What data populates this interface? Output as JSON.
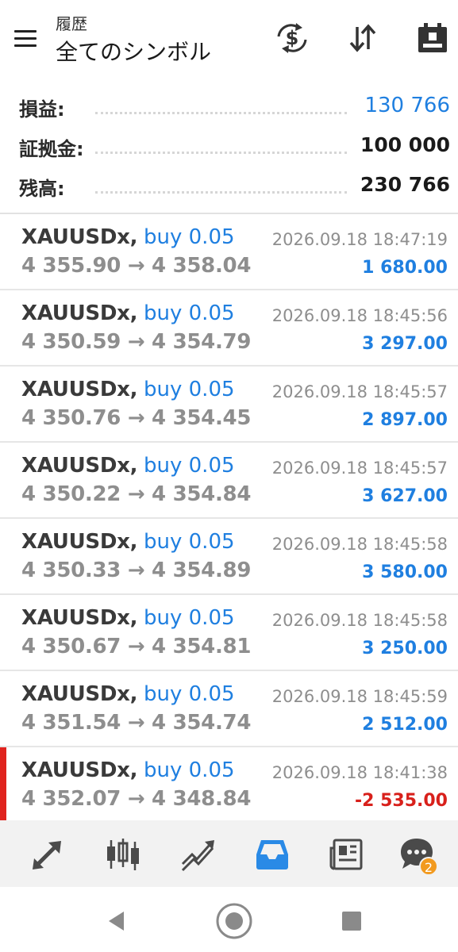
{
  "header": {
    "subtitle": "履歴",
    "title": "全てのシンボル",
    "icons": [
      "menu-icon",
      "dollar-exchange-icon",
      "sort-icon",
      "calendar-icon"
    ]
  },
  "summary": {
    "profit_label": "損益:",
    "profit_value": "130 766",
    "margin_label": "証拠金:",
    "margin_value": "100 000",
    "balance_label": "残高:",
    "balance_value": "230 766"
  },
  "deals": [
    {
      "symbol": "XAUUSDx,",
      "side": "buy 0.05",
      "prices": "4 355.90 → 4 358.04",
      "time": "2026.09.18 18:47:19",
      "profit": "1 680.00",
      "loss": false
    },
    {
      "symbol": "XAUUSDx,",
      "side": "buy 0.05",
      "prices": "4 350.59 → 4 354.79",
      "time": "2026.09.18 18:45:56",
      "profit": "3 297.00",
      "loss": false
    },
    {
      "symbol": "XAUUSDx,",
      "side": "buy 0.05",
      "prices": "4 350.76 → 4 354.45",
      "time": "2026.09.18 18:45:57",
      "profit": "2 897.00",
      "loss": false
    },
    {
      "symbol": "XAUUSDx,",
      "side": "buy 0.05",
      "prices": "4 350.22 → 4 354.84",
      "time": "2026.09.18 18:45:57",
      "profit": "3 627.00",
      "loss": false
    },
    {
      "symbol": "XAUUSDx,",
      "side": "buy 0.05",
      "prices": "4 350.33 → 4 354.89",
      "time": "2026.09.18 18:45:58",
      "profit": "3 580.00",
      "loss": false
    },
    {
      "symbol": "XAUUSDx,",
      "side": "buy 0.05",
      "prices": "4 350.67 → 4 354.81",
      "time": "2026.09.18 18:45:58",
      "profit": "3 250.00",
      "loss": false
    },
    {
      "symbol": "XAUUSDx,",
      "side": "buy 0.05",
      "prices": "4 351.54 → 4 354.74",
      "time": "2026.09.18 18:45:59",
      "profit": "2 512.00",
      "loss": false
    },
    {
      "symbol": "XAUUSDx,",
      "side": "buy 0.05",
      "prices": "4 352.07 → 4 348.84",
      "time": "2026.09.18 18:41:38",
      "profit": "-2 535.00",
      "loss": true
    }
  ],
  "bottom_nav": {
    "items": [
      "quotes-icon",
      "chart-icon",
      "trade-icon",
      "history-icon",
      "news-icon",
      "chat-icon"
    ],
    "active": "history-icon",
    "chat_badge": "2"
  },
  "system_nav": [
    "back-icon",
    "home-icon",
    "recents-icon"
  ],
  "colors": {
    "accent": "#1f7fe0",
    "loss": "#d8201b",
    "loss_marker": "#e0231e",
    "badge": "#f29a1f",
    "muted": "#8e8e8e"
  }
}
